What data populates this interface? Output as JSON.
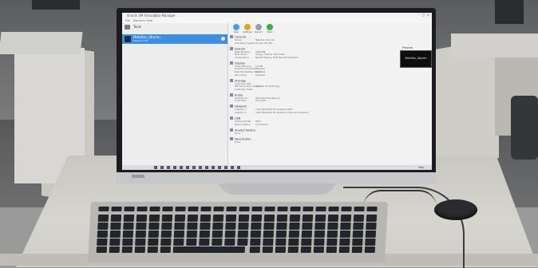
{
  "app": {
    "window_title": "Oracle VM VirtualBox Manager",
    "menu": [
      "File",
      "Machine",
      "Help"
    ],
    "tools_label": "Tools"
  },
  "vm": {
    "name": "MetaSec_Ubuntu",
    "state": "Powered Off"
  },
  "toolbar": {
    "buttons": [
      {
        "label": "New",
        "icon": "new-vm-icon",
        "color": "#4a9be8"
      },
      {
        "label": "Settings",
        "icon": "gear-icon",
        "color": "#e0a526"
      },
      {
        "label": "Discard",
        "icon": "discard-icon",
        "color": "#9aa0a8"
      },
      {
        "label": "Start",
        "icon": "start-arrow-icon",
        "color": "#3fae3f"
      }
    ]
  },
  "details": {
    "sections": [
      {
        "title": "General",
        "rows": [
          [
            "Name:",
            "MetaSec_Ubuntu"
          ],
          [
            "Operating System:",
            "Ubuntu (64-bit)"
          ]
        ]
      },
      {
        "title": "System",
        "rows": [
          [
            "Base Memory:",
            "2048 MB"
          ],
          [
            "Boot Order:",
            "Floppy, Optical, Hard Disk"
          ],
          [
            "Acceleration:",
            "Nested Paging, KVM Paravirtualization"
          ]
        ]
      },
      {
        "title": "Display",
        "rows": [
          [
            "Video Memory:",
            "16 MB"
          ],
          [
            "Graphics Controller:",
            "VMSVGA"
          ],
          [
            "Remote Desktop Server:",
            "Disabled"
          ],
          [
            "Recording:",
            "Disabled"
          ]
        ]
      },
      {
        "title": "Storage",
        "rows": [
          [
            "Controller: IDE",
            ""
          ],
          [
            "IDE Secondary Device 0:",
            "[Optical Drive] Empty"
          ],
          [
            "Controller: SATA",
            ""
          ]
        ]
      },
      {
        "title": "Audio",
        "rows": [
          [
            "Host Driver:",
            "Windows DirectSound"
          ],
          [
            "Controller:",
            "ICH AC97"
          ]
        ]
      },
      {
        "title": "Network",
        "rows": [
          [
            "Adapter 1:",
            "Intel PRO/1000 MT Desktop (NAT)"
          ],
          [
            "Adapter 2:",
            "Intel PRO/1000 MT Desktop (Host-only Adapter)"
          ]
        ]
      },
      {
        "title": "USB",
        "rows": [
          [
            "USB Controller:",
            "OHCI"
          ],
          [
            "Device Filters:",
            "0 (0 active)"
          ]
        ]
      },
      {
        "title": "Shared folders",
        "rows": [
          [
            "None",
            ""
          ]
        ]
      },
      {
        "title": "Description",
        "rows": [
          [
            "None",
            ""
          ]
        ]
      }
    ]
  },
  "preview": {
    "label": "Preview",
    "text": "MetaSec_Ubuntu"
  },
  "taskbar": {
    "tray_text": "ENG"
  },
  "colors": {
    "selection": "#3d8fe0",
    "screen_bg": "#e8e6e8",
    "bezel": "#1b1c1f"
  }
}
